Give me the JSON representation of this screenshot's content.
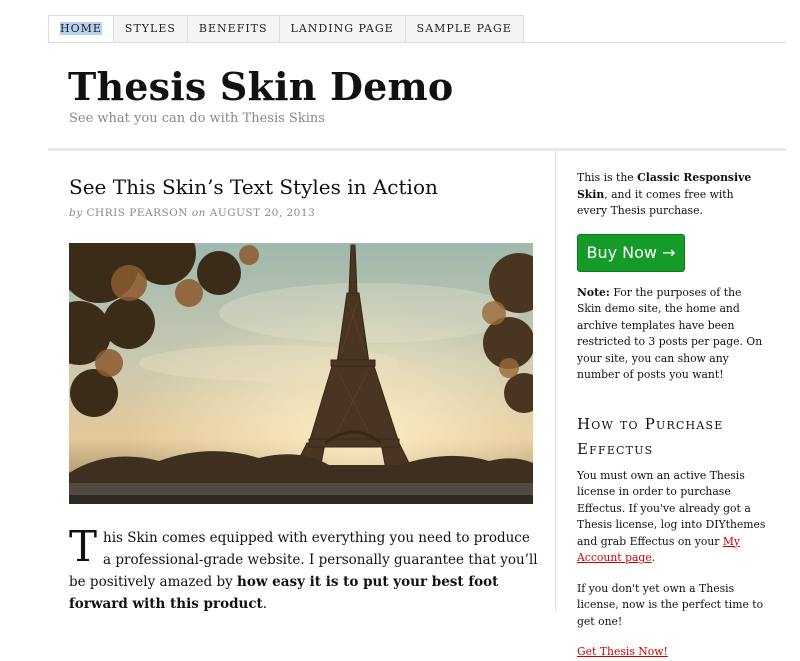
{
  "nav": {
    "items": [
      {
        "label": "HOME",
        "active": true
      },
      {
        "label": "STYLES"
      },
      {
        "label": "BENEFITS"
      },
      {
        "label": "LANDING PAGE"
      },
      {
        "label": "SAMPLE PAGE"
      }
    ]
  },
  "header": {
    "title": "Thesis Skin Demo",
    "tagline": "See what you can do with Thesis Skins"
  },
  "post": {
    "title": "See This Skin’s Text Styles in Action",
    "byline_by": "by",
    "author": "Chris Pearson",
    "byline_on": "on",
    "date": "August 20, 2013",
    "image_alt": "Eiffel Tower at sunset",
    "dropcap": "T",
    "body_part1": "his Skin comes equipped with everything you need to produce a professional-grade website. I personally guarantee that you’ll be positively amazed by ",
    "body_bold": "how easy it is to put your best foot forward with this product",
    "body_end": "."
  },
  "sidebar": {
    "intro_pre": "This is the ",
    "intro_bold": "Classic Responsive Skin",
    "intro_post": ", and it comes free with every Thesis purchase.",
    "buy_button": "Buy Now →",
    "note_label": "Note:",
    "note_text": " For the purposes of the Skin demo site, the home and archive templates have been restricted to 3 posts per page. On your site, you can show any number of posts you want!",
    "widget_title": "How to Purchase Effectus",
    "widget_text_1": "You must own an active Thesis license in order to purchase Effectus. If you've already got a Thesis license, log into DIYthemes and grab Effectus on your ",
    "account_link": "My Account page",
    "widget_text_1_end": ".",
    "widget_text_2": "If you don't yet own a Thesis license, now is the perfect time to get one!",
    "get_thesis_link": "Get Thesis Now!"
  },
  "colors": {
    "buy_button": "#159b27",
    "link": "#cc0000",
    "active_nav_highlight": "#b7d0f0"
  }
}
